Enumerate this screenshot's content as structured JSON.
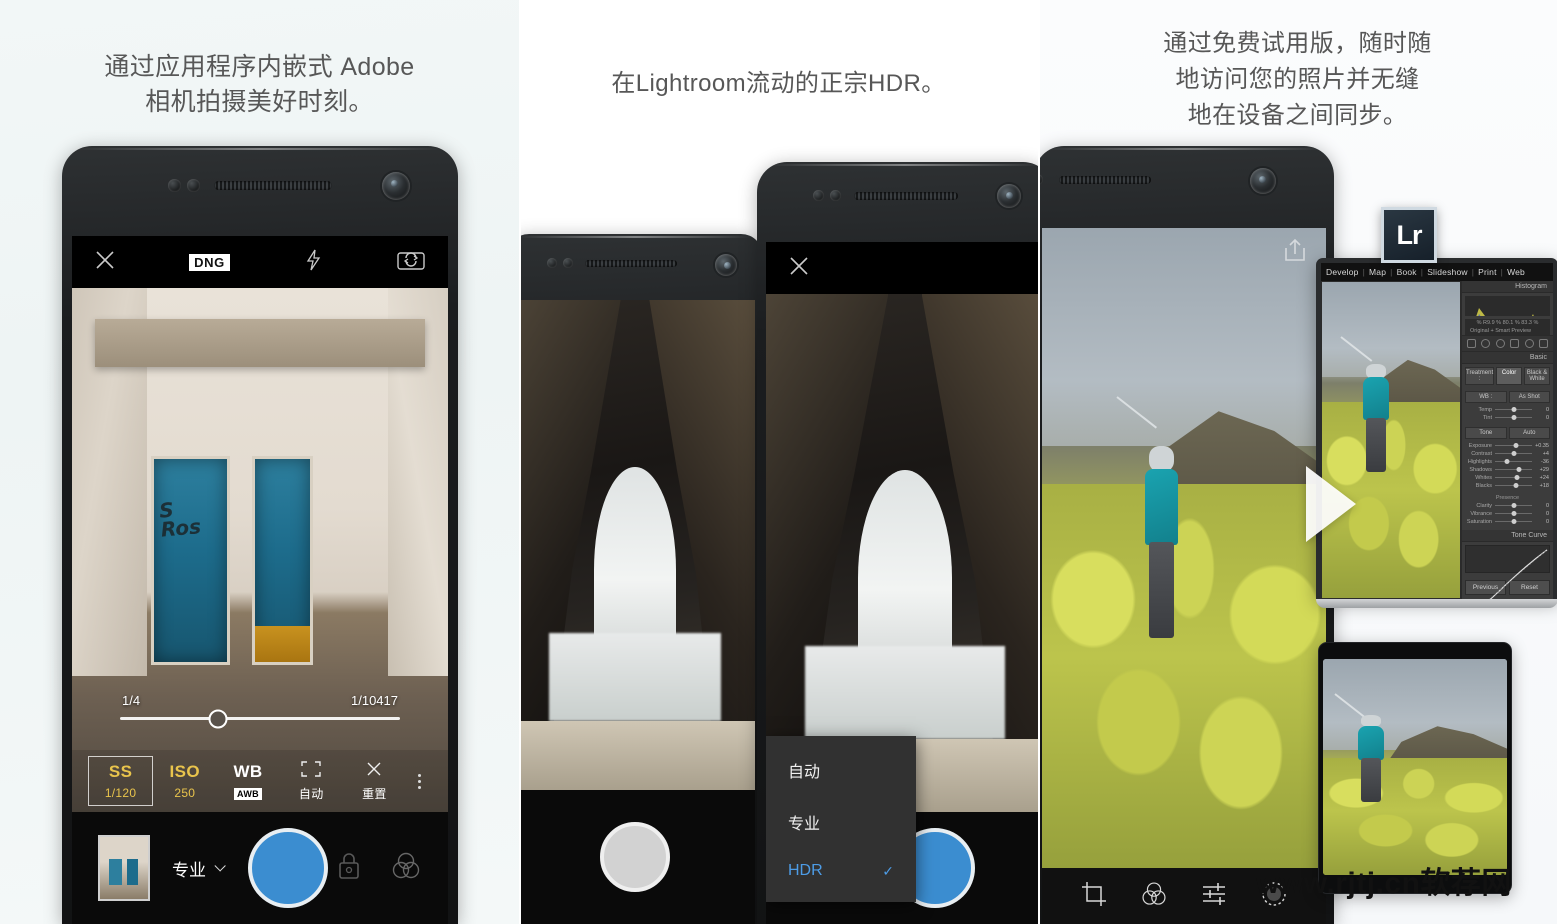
{
  "panels": [
    {
      "headline": "通过应用程序内嵌式 Adobe\n相机拍摄美好时刻。",
      "headline_l1": "通过应用程序内嵌式 Adobe",
      "headline_l2": "相机拍摄美好时刻。",
      "camera": {
        "close_icon": "close-icon",
        "format_badge": "DNG",
        "flash_icon": "flash-icon",
        "flip_icon": "camera-flip-icon",
        "exposure": {
          "min_label": "1/4",
          "max_label": "1/10417",
          "knob_percent": 35
        },
        "controls": [
          {
            "title": "SS",
            "value": "1/120",
            "style": "amber",
            "selected": true
          },
          {
            "title": "ISO",
            "value": "250",
            "style": "amber",
            "selected": false
          },
          {
            "title": "WB",
            "value": "AWB",
            "style": "white",
            "selected": false
          },
          {
            "title": "",
            "value": "自动",
            "style": "white",
            "selected": false,
            "icon": "focus-frame-icon"
          },
          {
            "title": "",
            "value": "重置",
            "style": "white",
            "selected": false,
            "icon": "reset-x-icon"
          }
        ],
        "more_icon": "more-vertical-icon",
        "thumbnail_name": "last-photo-thumbnail",
        "mode_label": "专业",
        "mode_chevron": "chevron-down-icon",
        "shutter_name": "shutter-button",
        "lock_icon": "lock-icon",
        "presets_icon": "color-presets-icon"
      }
    },
    {
      "headline_l1": "在Lightroom流动的正宗HDR。",
      "dropdown": {
        "items": [
          {
            "label": "自动",
            "selected": false
          },
          {
            "label": "专业",
            "selected": false
          },
          {
            "label": "HDR",
            "selected": true
          }
        ],
        "check_glyph": "✓"
      },
      "close_icon": "close-icon",
      "shutter_back_name": "shutter-button-background-phone",
      "shutter_front_name": "shutter-button-foreground-phone"
    },
    {
      "headline_l1": "通过免费试用版，随时随",
      "headline_l2": "地访问您的照片并无缝",
      "headline_l3": "地在设备之间同步。",
      "share_icon": "share-icon",
      "bottom_tools": [
        {
          "icon": "crop-icon",
          "name": "crop-tool"
        },
        {
          "icon": "presets-icon",
          "name": "color-presets-tool"
        },
        {
          "icon": "sliders-icon",
          "name": "adjustments-tool"
        },
        {
          "icon": "effects-icon",
          "name": "effects-tool"
        }
      ],
      "lightroom": {
        "logo_text": "Lr",
        "modules": [
          "Develop",
          "Map",
          "Book",
          "Slideshow",
          "Print",
          "Web"
        ],
        "module_separator": "|",
        "panels": {
          "histogram_title": "Histogram",
          "rgb_readout": "%  R9.9  %  80.1  %  83.3 %",
          "smart_preview": "Original + Smart Preview",
          "basic_title": "Basic",
          "treatment_label": "Treatment :",
          "treatment_options": [
            "Color",
            "Black & White"
          ],
          "treatment_selected": "Color",
          "wb_label": "WB :",
          "wb_value": "As Shot",
          "wb_sliders": [
            {
              "name": "Temp",
              "value": "0"
            },
            {
              "name": "Tint",
              "value": "0"
            }
          ],
          "tone_label": "Tone",
          "tone_auto": "Auto",
          "tone_sliders": [
            {
              "name": "Exposure",
              "value": "+0.35"
            },
            {
              "name": "Contrast",
              "value": "+4"
            },
            {
              "name": "Highlights",
              "value": "-36"
            },
            {
              "name": "Shadows",
              "value": "+29"
            },
            {
              "name": "Whites",
              "value": "+24"
            },
            {
              "name": "Blacks",
              "value": "+18"
            }
          ],
          "presence_label": "Presence",
          "presence_sliders": [
            {
              "name": "Clarity",
              "value": "0"
            },
            {
              "name": "Vibrance",
              "value": "0"
            },
            {
              "name": "Saturation",
              "value": "0"
            }
          ],
          "tone_curve_title": "Tone Curve",
          "buttons": [
            "Previous",
            "Reset"
          ]
        }
      }
    }
  ],
  "watermark": "www.rjtj.cn软荐网",
  "colors": {
    "accent_blue": "#3b8dd0",
    "amber": "#e9c44c",
    "menu_blue": "#4d9ce6",
    "panel_bg_1": "#f0f6f6",
    "dark_chrome": "#0a0a0a"
  }
}
